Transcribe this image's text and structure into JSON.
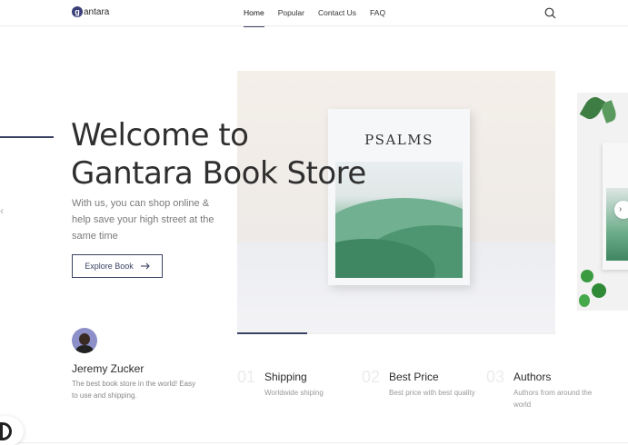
{
  "header": {
    "logo_mark": "g",
    "logo_text": "antara",
    "nav": [
      {
        "label": "Home",
        "active": true
      },
      {
        "label": "Popular",
        "active": false
      },
      {
        "label": "Contact Us",
        "active": false
      },
      {
        "label": "FAQ",
        "active": false
      }
    ],
    "search_icon": "search-icon"
  },
  "hero": {
    "title_line1": "Welcome to",
    "title_line2": "Gantara Book Store",
    "description": "With us, you can shop online & help save your high street at the same time",
    "cta_label": "Explore Book",
    "cta_icon": "arrow-right-icon",
    "prev_icon": "chevron-left-icon",
    "next_icon": "chevron-right-icon",
    "book_cover_title": "PSALMS",
    "slide_progress": 0.22
  },
  "testimonial": {
    "name": "Jeremy Zucker",
    "quote": "The best book store in the world! Easy to use and shipping."
  },
  "features": [
    {
      "number": "01",
      "title": "Shipping",
      "description": "Worldwide shiping"
    },
    {
      "number": "02",
      "title": "Best Price",
      "description": "Best price with best quality"
    },
    {
      "number": "03",
      "title": "Authors",
      "description": "Authors from around the world"
    }
  ],
  "colors": {
    "accent": "#3a4263",
    "text": "#2b2b2b",
    "muted": "#7a7a7a"
  }
}
